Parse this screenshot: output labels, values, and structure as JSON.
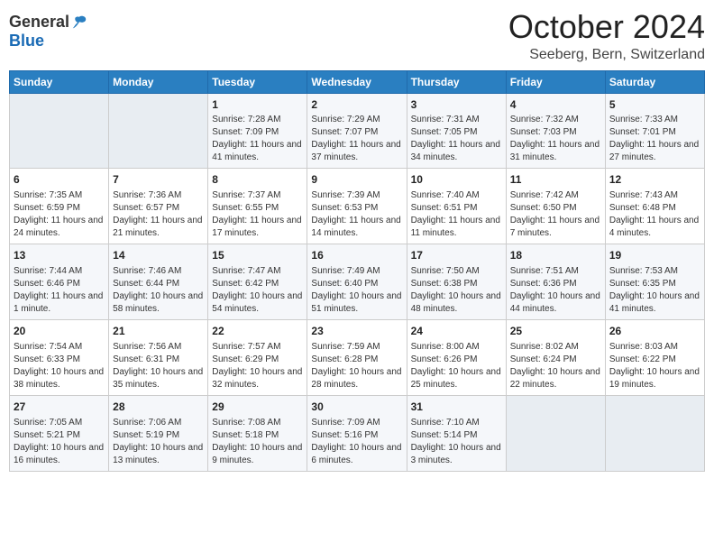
{
  "header": {
    "logo_general": "General",
    "logo_blue": "Blue",
    "month_title": "October 2024",
    "location": "Seeberg, Bern, Switzerland"
  },
  "days_of_week": [
    "Sunday",
    "Monday",
    "Tuesday",
    "Wednesday",
    "Thursday",
    "Friday",
    "Saturday"
  ],
  "weeks": [
    [
      {
        "day": "",
        "empty": true
      },
      {
        "day": "",
        "empty": true
      },
      {
        "day": "1",
        "sunrise": "Sunrise: 7:28 AM",
        "sunset": "Sunset: 7:09 PM",
        "daylight": "Daylight: 11 hours and 41 minutes."
      },
      {
        "day": "2",
        "sunrise": "Sunrise: 7:29 AM",
        "sunset": "Sunset: 7:07 PM",
        "daylight": "Daylight: 11 hours and 37 minutes."
      },
      {
        "day": "3",
        "sunrise": "Sunrise: 7:31 AM",
        "sunset": "Sunset: 7:05 PM",
        "daylight": "Daylight: 11 hours and 34 minutes."
      },
      {
        "day": "4",
        "sunrise": "Sunrise: 7:32 AM",
        "sunset": "Sunset: 7:03 PM",
        "daylight": "Daylight: 11 hours and 31 minutes."
      },
      {
        "day": "5",
        "sunrise": "Sunrise: 7:33 AM",
        "sunset": "Sunset: 7:01 PM",
        "daylight": "Daylight: 11 hours and 27 minutes."
      }
    ],
    [
      {
        "day": "6",
        "sunrise": "Sunrise: 7:35 AM",
        "sunset": "Sunset: 6:59 PM",
        "daylight": "Daylight: 11 hours and 24 minutes."
      },
      {
        "day": "7",
        "sunrise": "Sunrise: 7:36 AM",
        "sunset": "Sunset: 6:57 PM",
        "daylight": "Daylight: 11 hours and 21 minutes."
      },
      {
        "day": "8",
        "sunrise": "Sunrise: 7:37 AM",
        "sunset": "Sunset: 6:55 PM",
        "daylight": "Daylight: 11 hours and 17 minutes."
      },
      {
        "day": "9",
        "sunrise": "Sunrise: 7:39 AM",
        "sunset": "Sunset: 6:53 PM",
        "daylight": "Daylight: 11 hours and 14 minutes."
      },
      {
        "day": "10",
        "sunrise": "Sunrise: 7:40 AM",
        "sunset": "Sunset: 6:51 PM",
        "daylight": "Daylight: 11 hours and 11 minutes."
      },
      {
        "day": "11",
        "sunrise": "Sunrise: 7:42 AM",
        "sunset": "Sunset: 6:50 PM",
        "daylight": "Daylight: 11 hours and 7 minutes."
      },
      {
        "day": "12",
        "sunrise": "Sunrise: 7:43 AM",
        "sunset": "Sunset: 6:48 PM",
        "daylight": "Daylight: 11 hours and 4 minutes."
      }
    ],
    [
      {
        "day": "13",
        "sunrise": "Sunrise: 7:44 AM",
        "sunset": "Sunset: 6:46 PM",
        "daylight": "Daylight: 11 hours and 1 minute."
      },
      {
        "day": "14",
        "sunrise": "Sunrise: 7:46 AM",
        "sunset": "Sunset: 6:44 PM",
        "daylight": "Daylight: 10 hours and 58 minutes."
      },
      {
        "day": "15",
        "sunrise": "Sunrise: 7:47 AM",
        "sunset": "Sunset: 6:42 PM",
        "daylight": "Daylight: 10 hours and 54 minutes."
      },
      {
        "day": "16",
        "sunrise": "Sunrise: 7:49 AM",
        "sunset": "Sunset: 6:40 PM",
        "daylight": "Daylight: 10 hours and 51 minutes."
      },
      {
        "day": "17",
        "sunrise": "Sunrise: 7:50 AM",
        "sunset": "Sunset: 6:38 PM",
        "daylight": "Daylight: 10 hours and 48 minutes."
      },
      {
        "day": "18",
        "sunrise": "Sunrise: 7:51 AM",
        "sunset": "Sunset: 6:36 PM",
        "daylight": "Daylight: 10 hours and 44 minutes."
      },
      {
        "day": "19",
        "sunrise": "Sunrise: 7:53 AM",
        "sunset": "Sunset: 6:35 PM",
        "daylight": "Daylight: 10 hours and 41 minutes."
      }
    ],
    [
      {
        "day": "20",
        "sunrise": "Sunrise: 7:54 AM",
        "sunset": "Sunset: 6:33 PM",
        "daylight": "Daylight: 10 hours and 38 minutes."
      },
      {
        "day": "21",
        "sunrise": "Sunrise: 7:56 AM",
        "sunset": "Sunset: 6:31 PM",
        "daylight": "Daylight: 10 hours and 35 minutes."
      },
      {
        "day": "22",
        "sunrise": "Sunrise: 7:57 AM",
        "sunset": "Sunset: 6:29 PM",
        "daylight": "Daylight: 10 hours and 32 minutes."
      },
      {
        "day": "23",
        "sunrise": "Sunrise: 7:59 AM",
        "sunset": "Sunset: 6:28 PM",
        "daylight": "Daylight: 10 hours and 28 minutes."
      },
      {
        "day": "24",
        "sunrise": "Sunrise: 8:00 AM",
        "sunset": "Sunset: 6:26 PM",
        "daylight": "Daylight: 10 hours and 25 minutes."
      },
      {
        "day": "25",
        "sunrise": "Sunrise: 8:02 AM",
        "sunset": "Sunset: 6:24 PM",
        "daylight": "Daylight: 10 hours and 22 minutes."
      },
      {
        "day": "26",
        "sunrise": "Sunrise: 8:03 AM",
        "sunset": "Sunset: 6:22 PM",
        "daylight": "Daylight: 10 hours and 19 minutes."
      }
    ],
    [
      {
        "day": "27",
        "sunrise": "Sunrise: 7:05 AM",
        "sunset": "Sunset: 5:21 PM",
        "daylight": "Daylight: 10 hours and 16 minutes."
      },
      {
        "day": "28",
        "sunrise": "Sunrise: 7:06 AM",
        "sunset": "Sunset: 5:19 PM",
        "daylight": "Daylight: 10 hours and 13 minutes."
      },
      {
        "day": "29",
        "sunrise": "Sunrise: 7:08 AM",
        "sunset": "Sunset: 5:18 PM",
        "daylight": "Daylight: 10 hours and 9 minutes."
      },
      {
        "day": "30",
        "sunrise": "Sunrise: 7:09 AM",
        "sunset": "Sunset: 5:16 PM",
        "daylight": "Daylight: 10 hours and 6 minutes."
      },
      {
        "day": "31",
        "sunrise": "Sunrise: 7:10 AM",
        "sunset": "Sunset: 5:14 PM",
        "daylight": "Daylight: 10 hours and 3 minutes."
      },
      {
        "day": "",
        "empty": true
      },
      {
        "day": "",
        "empty": true
      }
    ]
  ]
}
